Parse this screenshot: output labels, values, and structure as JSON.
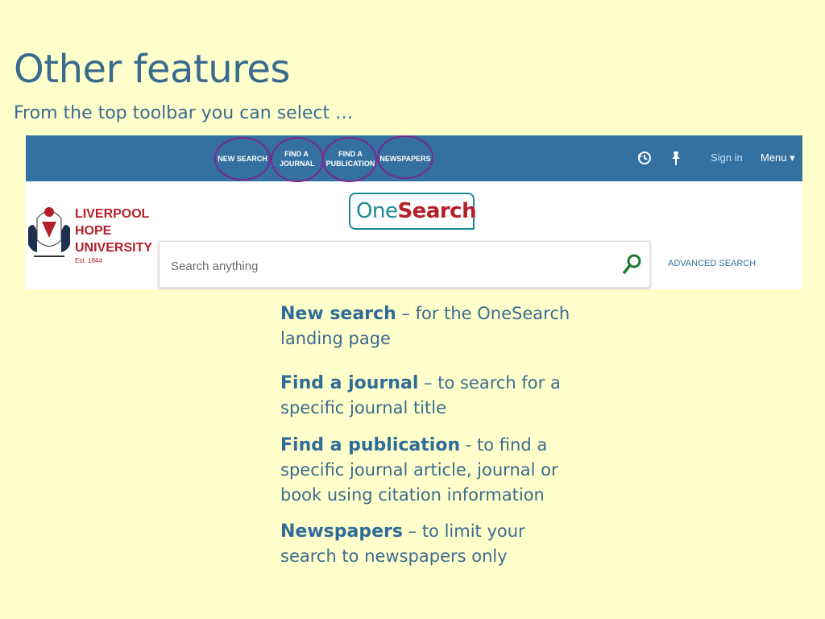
{
  "slide": {
    "title": "Other features",
    "subtitle": "From the top toolbar you can select …"
  },
  "toolbar": {
    "items": [
      {
        "label": "NEW SEARCH"
      },
      {
        "label": "FIND A JOURNAL"
      },
      {
        "label": "FIND A PUBLICATION"
      },
      {
        "label": "NEWSPAPERS"
      }
    ],
    "history_icon": "history-icon",
    "pin_icon": "pin-icon",
    "sign_in": "Sign in",
    "menu": "Menu ▾"
  },
  "logo": {
    "university_line1": "LIVERPOOL",
    "university_line2": "HOPE",
    "university_line3": "UNIVERSITY",
    "established": "Est. 1844",
    "product_one": "One",
    "product_search": "Search"
  },
  "search": {
    "placeholder": "Search anything",
    "advanced_label": "ADVANCED SEARCH"
  },
  "descriptions": [
    {
      "term": "New search",
      "text": " – for the OneSearch landing page"
    },
    {
      "term": "Find a journal",
      "text": " – to search for a specific journal title"
    },
    {
      "term": "Find a publication",
      "text": " -  to find a specific journal article, journal or book using citation information"
    },
    {
      "term": "Newspapers",
      "text": " – to limit your search to newspapers only"
    }
  ],
  "colors": {
    "background": "#ffffcc",
    "toolbar": "#3471a1",
    "highlight_circle": "#7a2a8f",
    "title": "#3a6b8f"
  }
}
